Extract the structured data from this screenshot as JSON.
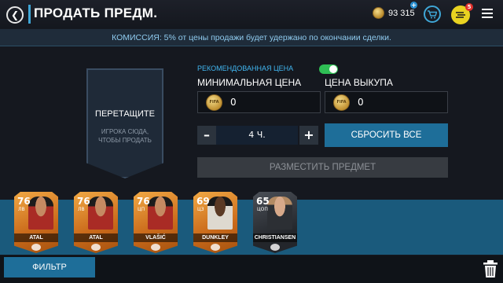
{
  "header": {
    "back_icon": "back-arrow-icon",
    "title": "ПРОДАТЬ ПРЕДМ.",
    "coins": "93 315",
    "packs_badge": "5"
  },
  "notice": "КОМИССИЯ: 5% от цены продажи будет удержано по окончании сделки.",
  "drop_zone": {
    "title": "ПЕРЕТАЩИТЕ",
    "subtitle": "ИГРОКА СЮДА, ЧТОБЫ ПРОДАТЬ"
  },
  "form": {
    "recommended_label": "РЕКОМЕНДОВАННАЯ ЦЕНА",
    "recommended_on": true,
    "min_price_label": "МИНИМАЛЬНАЯ ЦЕНА",
    "min_price_value": "0",
    "buyout_label": "ЦЕНА ВЫКУПА",
    "buyout_value": "0",
    "duration": "4 Ч.",
    "minus": "–",
    "plus": "+",
    "reset_label": "СБРОСИТЬ ВСЕ",
    "list_label": "РАЗМЕСТИТЬ ПРЕДМЕТ",
    "coin_text": "FIFA"
  },
  "cards": [
    {
      "rating": "76",
      "position": "ЛВ",
      "name": "ATAL",
      "style": "gold"
    },
    {
      "rating": "76",
      "position": "ЛВ",
      "name": "ATAL",
      "style": "gold"
    },
    {
      "rating": "76",
      "position": "ЦП",
      "name": "VLAŠIĆ",
      "style": "gold"
    },
    {
      "rating": "69",
      "position": "ЦЗ",
      "name": "DUNKLEY",
      "style": "gold blue-kit"
    },
    {
      "rating": "65",
      "position": "ЦОП",
      "name": "CHRISTIANSEN",
      "style": "black"
    }
  ],
  "bottom": {
    "filter_label": "ФИЛЬТР"
  },
  "colors": {
    "accent": "#1e6e99",
    "notice_text": "#8fcbef",
    "toggle_on": "#2fbf55",
    "tray": "#1a5a7c"
  }
}
